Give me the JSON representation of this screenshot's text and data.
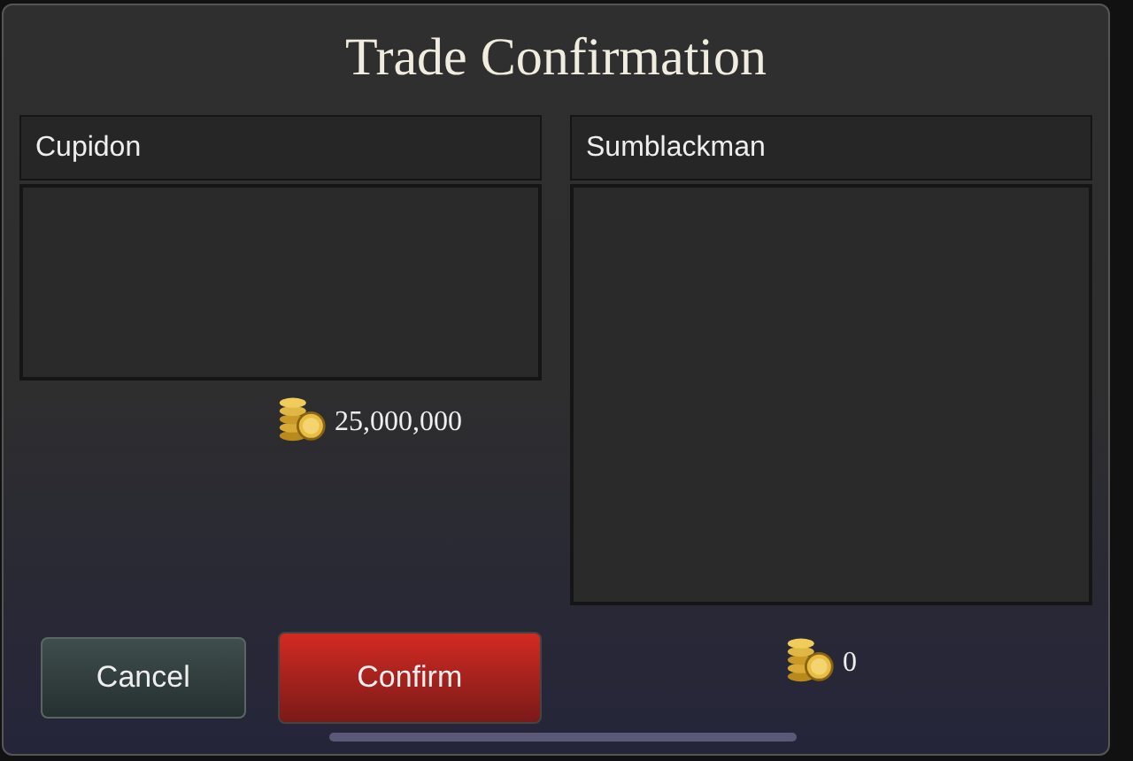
{
  "window": {
    "title": "Trade Confirmation"
  },
  "traders": [
    {
      "name": "Cupidon",
      "amount": "25,000,000"
    },
    {
      "name": "Sumblackman",
      "amount": "0"
    }
  ],
  "buttons": [
    {
      "label": "Cancel",
      "kind": "cancel"
    },
    {
      "label": "Confirm",
      "kind": "confirm"
    }
  ]
}
